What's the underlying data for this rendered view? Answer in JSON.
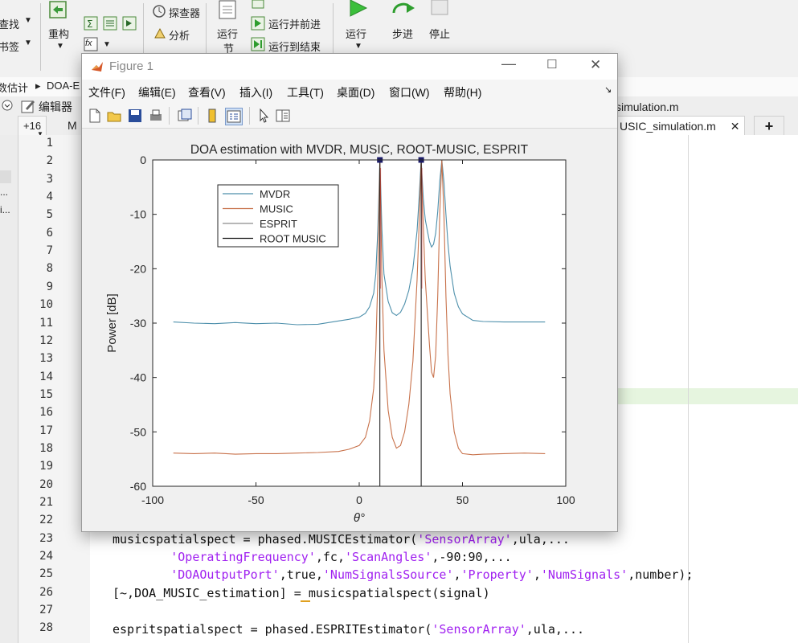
{
  "toolstrip": {
    "find": "查找",
    "bookmark": "书签",
    "refactor": "重构",
    "explorer": "探查器",
    "analyze": "分析",
    "run_section_1": "运行",
    "run_section_2": "节",
    "run_advance": "运行并前进",
    "run_to_end": "运行到结束",
    "run": "运行",
    "step": "步进",
    "stop": "停止",
    "fx": "fx"
  },
  "breadcrumb": {
    "item1": "数估计",
    "item2": "DOA-E"
  },
  "editor": {
    "panel_label": "编辑器",
    "tab_stub": "+16",
    "tab_m": "M",
    "file_tab_1": "simulation.m",
    "file_tab_2": "USIC_simulation.m",
    "new_tab": "+",
    "line_numbers": [
      "1",
      "2",
      "3",
      "4",
      "5",
      "6",
      "7",
      "8",
      "9",
      "10",
      "11",
      "12",
      "13",
      "14",
      "15",
      "16",
      "17",
      "18",
      "19",
      "20",
      "21",
      "22",
      "23",
      "24",
      "25",
      "26",
      "27",
      "28"
    ],
    "left_fragments": [
      "...",
      "i..."
    ]
  },
  "code": {
    "l23": [
      "musicspatialspect = phased.MUSICEstimator(",
      "'SensorArray'",
      ",ula,..."
    ],
    "l24": [
      "        ",
      "'OperatingFrequency'",
      ",fc,",
      "'ScanAngles'",
      ",-90:90,..."
    ],
    "l25": [
      "        ",
      "'DOAOutputPort'",
      ",true,",
      "'NumSignalsSource'",
      ",",
      "'Property'",
      ",",
      "'NumSignals'",
      ",number);"
    ],
    "l26": "[~,DOA_MUSIC_estimation] = musicspatialspect(signal)",
    "l28": [
      "espritspatialspect = phased.ESPRITEstimator(",
      "'SensorArray'",
      ",ula,..."
    ]
  },
  "figure": {
    "title": "Figure 1",
    "menus": [
      "文件(F)",
      "编辑(E)",
      "查看(V)",
      "插入(I)",
      "工具(T)",
      "桌面(D)",
      "窗口(W)",
      "帮助(H)"
    ]
  },
  "colors": {
    "mvdr": "#4d8fab",
    "music": "#c8724b",
    "esprit": "#8c8c8c",
    "root_music": "#111111",
    "marker": "#1a1a66",
    "red_line": "#cc2222"
  },
  "chart_data": {
    "type": "line",
    "title": "DOA estimation with MVDR, MUSIC, ROOT-MUSIC, ESPRIT",
    "xlabel": "θ°",
    "ylabel": "Power [dB]",
    "xlim": [
      -100,
      100
    ],
    "ylim": [
      -60,
      0
    ],
    "xticks": [
      -100,
      -50,
      0,
      50,
      100
    ],
    "yticks": [
      0,
      -10,
      -20,
      -30,
      -40,
      -50,
      -60
    ],
    "legend_placement": "top-left",
    "grid": false,
    "series": [
      {
        "name": "MVDR",
        "color_key": "mvdr",
        "x": [
          -90,
          -80,
          -70,
          -60,
          -50,
          -40,
          -30,
          -20,
          -10,
          -5,
          0,
          3,
          5,
          7,
          8,
          9,
          10,
          11,
          12,
          14,
          16,
          18,
          20,
          22,
          24,
          26,
          28,
          29,
          30,
          31,
          32,
          34,
          35,
          36,
          37,
          38,
          39,
          40,
          41,
          42,
          43,
          44,
          46,
          48,
          50,
          55,
          60,
          70,
          80,
          90
        ],
        "y": [
          -29.8,
          -30,
          -30.1,
          -29.9,
          -30.1,
          -30,
          -30.3,
          -30.2,
          -29.6,
          -29.3,
          -28.9,
          -28.2,
          -27,
          -24.5,
          -21,
          -13,
          0,
          -13,
          -21,
          -26,
          -28.1,
          -28.6,
          -28,
          -26.5,
          -24,
          -20,
          -13,
          -7,
          0,
          -7,
          -11,
          -15,
          -16,
          -15.5,
          -13.5,
          -9.5,
          -4,
          0,
          -4,
          -10,
          -15.5,
          -19.5,
          -24.5,
          -27,
          -28.3,
          -29.5,
          -29.7,
          -29.8,
          -29.8,
          -29.8
        ]
      },
      {
        "name": "MUSIC",
        "color_key": "music",
        "x": [
          -90,
          -80,
          -70,
          -60,
          -50,
          -40,
          -30,
          -20,
          -10,
          -5,
          0,
          3,
          5,
          7,
          8,
          9,
          10,
          11,
          12,
          14,
          16,
          18,
          20,
          22,
          24,
          26,
          28,
          29,
          30,
          31,
          32,
          34,
          35,
          36,
          37,
          38,
          39,
          40,
          41,
          42,
          43,
          44,
          46,
          48,
          50,
          55,
          60,
          70,
          80,
          90
        ],
        "y": [
          -53.9,
          -54,
          -53.9,
          -54.1,
          -54,
          -54,
          -53.9,
          -53.8,
          -53.6,
          -53.2,
          -52.5,
          -51,
          -48,
          -42,
          -35,
          -22,
          0,
          -22,
          -35,
          -46,
          -51,
          -53,
          -52.5,
          -50,
          -45,
          -37,
          -22,
          -12,
          0,
          -12,
          -22,
          -34,
          -39,
          -40,
          -36,
          -25,
          -10,
          0,
          -10,
          -25,
          -36,
          -43,
          -50,
          -53,
          -54,
          -54.2,
          -54.1,
          -54,
          -53.9,
          -54
        ]
      },
      {
        "name": "ESPRIT",
        "color_key": "esprit",
        "x": [],
        "y": []
      },
      {
        "name": "ROOT MUSIC",
        "color_key": "root_music",
        "vlines": [
          10,
          30
        ]
      }
    ],
    "markers": {
      "x": [
        10,
        30
      ],
      "y": [
        0,
        0
      ]
    }
  }
}
